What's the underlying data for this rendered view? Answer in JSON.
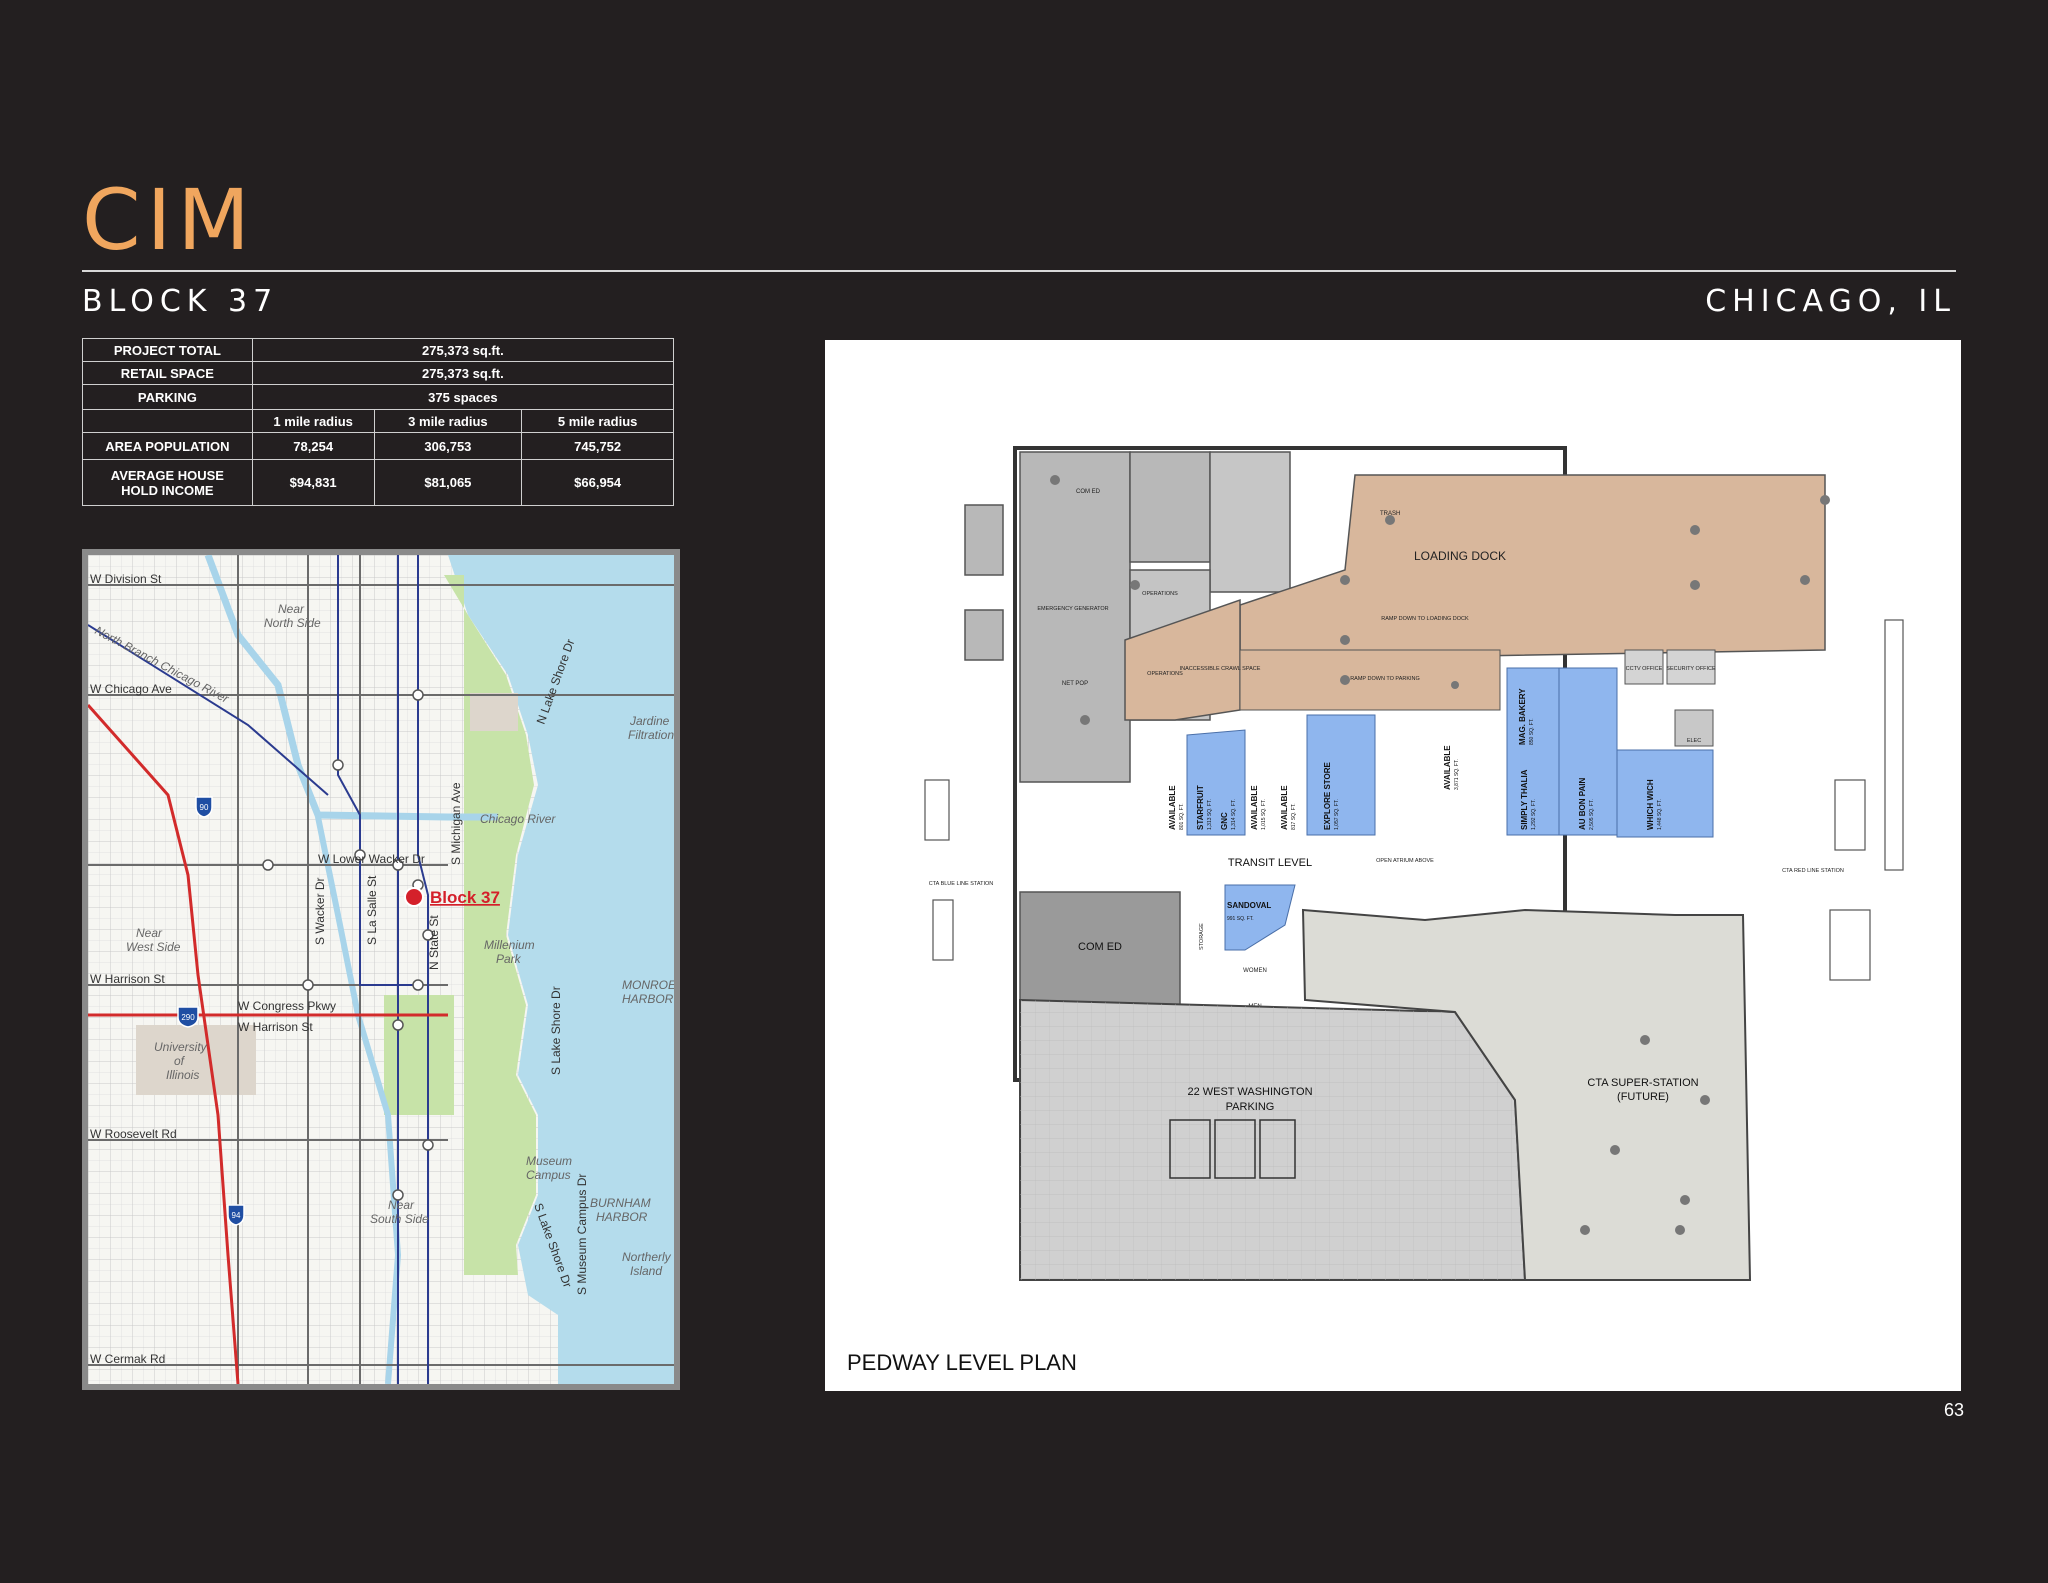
{
  "brand": {
    "logo": "CIM"
  },
  "header": {
    "property": "BLOCK 37",
    "location": "CHICAGO, IL"
  },
  "stats": {
    "project_total_label": "PROJECT TOTAL",
    "project_total": "275,373 sq.ft.",
    "retail_space_label": "RETAIL SPACE",
    "retail_space": "275,373 sq.ft.",
    "parking_label": "PARKING",
    "parking": "375 spaces",
    "radius_headers": [
      "1 mile radius",
      "3 mile radius",
      "5 mile radius"
    ],
    "population_label": "AREA POPULATION",
    "population": [
      "78,254",
      "306,753",
      "745,752"
    ],
    "income_label_1": "AVERAGE HOUSE",
    "income_label_2": "HOLD INCOME",
    "income": [
      "$94,831",
      "$81,065",
      "$66,954"
    ]
  },
  "map": {
    "marker_label": "Block 37",
    "streets": {
      "division": "W Division St",
      "chicago": "W Chicago Ave",
      "lower_wacker": "W Lower Wacker Dr",
      "harrison": "W Harrison St",
      "congress": "W Congress Pkwy",
      "harrison2": "W Harrison St",
      "roosevelt": "W Roosevelt Rd",
      "cermak": "W Cermak Rd",
      "wacker": "S Wacker Dr",
      "lasalle": "S La Salle St",
      "state": "N State St",
      "michigan": "S Michigan Ave",
      "lsd_n": "N Lake Shore Dr",
      "lsd_s": "S Lake Shore Dr",
      "lsd_s2": "S Lake Shore Dr",
      "museum_campus_dr": "S Museum Campus Dr"
    },
    "places": {
      "near_north": [
        "Near",
        "North Side"
      ],
      "north_branch": "North Branch Chicago River",
      "chicago_river": "Chicago River",
      "near_west": [
        "Near",
        "West Side"
      ],
      "uic": [
        "University",
        "of",
        "Illinois"
      ],
      "millennium": [
        "Millenium",
        "Park"
      ],
      "near_south": [
        "Near",
        "South Side"
      ],
      "museum_campus": [
        "Museum",
        "Campus"
      ],
      "monroe_harbor": [
        "MONROE",
        "HARBOR"
      ],
      "burnham_harbor": [
        "BURNHAM",
        "HARBOR"
      ],
      "northerly_island": [
        "Northerly",
        "Island"
      ],
      "jardine": [
        "Jardine",
        "Filtration"
      ]
    },
    "shields": [
      "90",
      "290",
      "94"
    ]
  },
  "plan": {
    "caption": "PEDWAY LEVEL PLAN",
    "labels": {
      "loading_dock": "LOADING DOCK",
      "ramp_loading": "RAMP DOWN TO LOADING DOCK",
      "ramp_parking": "RAMP DOWN TO PARKING",
      "transit_level": "TRANSIT LEVEL",
      "com_ed_small": "COM ED",
      "com_ed": "COM ED",
      "parking_1": "22 WEST WASHINGTON",
      "parking_2": "PARKING",
      "cta_1": "CTA SUPER-STATION",
      "cta_2": "(FUTURE)",
      "operations_1": "OPERATIONS",
      "operations_2": "OPERATIONS",
      "emergency": "EMERGENCY GENERATOR",
      "net_pop": "NET POP",
      "inaccessible": "INACCESSIBLE CRAWL SPACE",
      "trash": "TRASH",
      "cctv": "CCTV OFFICE",
      "security": "SECURITY OFFICE",
      "elec": "ELEC",
      "cta_blue": "CTA BLUE LINE STATION",
      "cta_red": "CTA RED LINE STATION",
      "open_atrium": "OPEN ATRIUM ABOVE",
      "women": "WOMEN",
      "men": "MEN",
      "storage": "STORAGE"
    },
    "tenants": [
      {
        "name": "AVAILABLE",
        "area": "801 SQ. FT."
      },
      {
        "name": "STARFRUIT",
        "area": "1,313 SQ. FT."
      },
      {
        "name": "GNC",
        "area": "1,314 SQ. FT."
      },
      {
        "name": "AVAILABLE",
        "area": "1,015 SQ. FT."
      },
      {
        "name": "AVAILABLE",
        "area": "817 SQ. FT."
      },
      {
        "name": "EXPLORE STORE",
        "area": "1,057 SQ. FT."
      },
      {
        "name": "AVAILABLE",
        "area": "3,871 SQ. FT."
      },
      {
        "name": "MAG. BAKERY",
        "area": "850 SQ. FT."
      },
      {
        "name": "SIMPLY THALIA",
        "area": "1,292 SQ. FT."
      },
      {
        "name": "AU BON PAIN",
        "area": "2,505 SQ. FT."
      },
      {
        "name": "WHICH WICH",
        "area": "1,448 SQ. FT."
      },
      {
        "name": "SANDOVAL",
        "area": "991 SQ. FT."
      }
    ]
  },
  "page_number": "63",
  "colors": {
    "accent": "#f0a65e",
    "background": "#231f20",
    "retail_blue": "#8fb6ee",
    "loading_tan": "#d8b79c"
  }
}
